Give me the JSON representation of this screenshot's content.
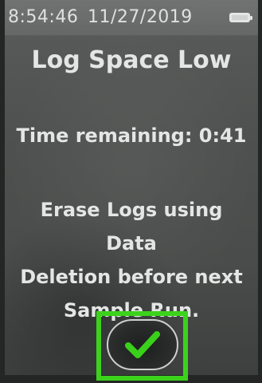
{
  "status_bar": {
    "time": "8:54:46",
    "date": "11/27/2019",
    "battery": {
      "icon": "battery-icon",
      "level_fraction": 1.0
    }
  },
  "dialog": {
    "title": "Log Space Low",
    "time_remaining": "Time remaining: 0:41",
    "message_lines": [
      "Erase Logs using Data",
      "Deletion before next",
      "Sample Run."
    ]
  },
  "confirm_button": {
    "icon": "checkmark-icon",
    "icon_color": "#3ad11b",
    "highlight_color": "#3cd21c"
  }
}
